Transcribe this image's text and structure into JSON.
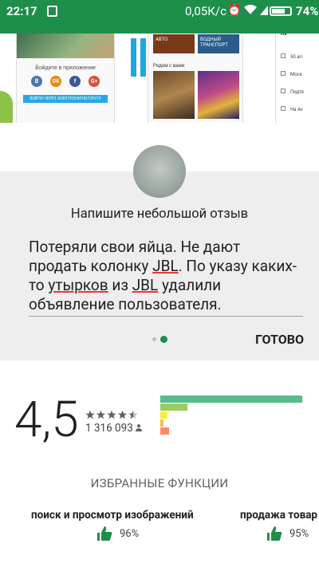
{
  "status_bar": {
    "time": "22:17",
    "speed": "0,05К/с",
    "battery_percent": "74%",
    "battery_level": 0.74
  },
  "banner": {
    "screen1": {
      "caption": "Войдите в приложение",
      "socials": [
        "В",
        "ОК",
        "f",
        "G+"
      ],
      "email_button": "ВОЙТИ ЧЕРЕЗ ЭЛЕКТРОННУЮ ПОЧТУ"
    },
    "screen2": {
      "tiles": [
        "АВТО",
        "ВОДНЫЙ ТРАНСПОРТ"
      ],
      "nearby_label": "Рядом с вами"
    },
    "screen3": {
      "title": "Ив",
      "rows": [
        "50 ал",
        "Моск",
        "Подте",
        "На Av"
      ]
    }
  },
  "review": {
    "heading": "Напишите небольшой отзыв",
    "text_parts": [
      "Потеряли свои яйца. Не дают продать колонку ",
      "JBL",
      ". По указу каких-то ",
      "утырков",
      " из ",
      "JBL",
      " удалили объявление пользователя."
    ],
    "done_button": "ГОТОВО",
    "page_indicator": {
      "pages": 2,
      "current": 2
    }
  },
  "rating": {
    "value": "4,5",
    "stars": 4.5,
    "count": "1 316 093",
    "distribution": [
      {
        "stars": 5,
        "fraction": 1.0,
        "color": "#57bb8a"
      },
      {
        "stars": 4,
        "fraction": 0.19,
        "color": "#9ccc65"
      },
      {
        "stars": 3,
        "fraction": 0.05,
        "color": "#ffeb3b"
      },
      {
        "stars": 2,
        "fraction": 0.02,
        "color": "#ffb74d"
      },
      {
        "stars": 1,
        "fraction": 0.06,
        "color": "#ff8a65"
      }
    ]
  },
  "features": {
    "title": "ИЗБРАННЫЕ ФУНКЦИИ",
    "items": [
      {
        "name": "поиск и просмотр изображений",
        "percent": "96%"
      },
      {
        "name": "продажа товар",
        "percent": "95%"
      }
    ]
  },
  "colors": {
    "brand_green": "#1e8e4b",
    "accent_blue": "#29a6e6",
    "error_underline": "#e53935"
  }
}
